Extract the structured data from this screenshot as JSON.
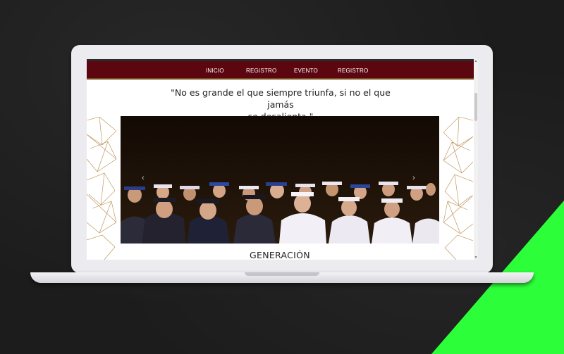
{
  "nav": {
    "items": [
      {
        "label": "INICIO"
      },
      {
        "label": "REGISTRO"
      },
      {
        "label": "EVENTO"
      },
      {
        "label": "REGISTRO"
      }
    ]
  },
  "hero": {
    "quote_line1": "\"No es grande el que siempre triunfa, si no el que jamás",
    "quote_line2": "se desalienta.\""
  },
  "carousel": {
    "prev_icon": "chevron-left-icon",
    "next_icon": "chevron-right-icon",
    "prev_glyph": "‹",
    "next_glyph": "›"
  },
  "section": {
    "title": "GENERACIÓN"
  },
  "colors": {
    "navbar": "#5c0610",
    "accent_green": "#2cff3a",
    "background": "#1c1c1c",
    "gold_line": "#b8894a"
  }
}
